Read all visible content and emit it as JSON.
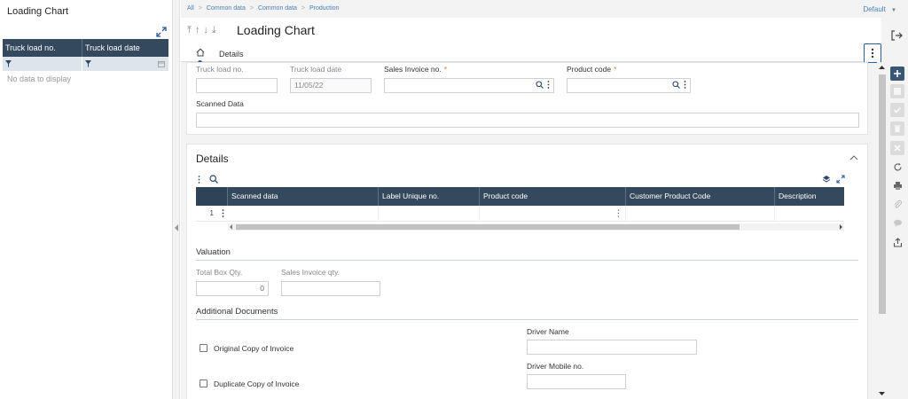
{
  "left_panel": {
    "title": "Loading Chart",
    "columns": [
      "Truck load no.",
      "Truck load date"
    ],
    "empty_text": "No data to display"
  },
  "breadcrumb": [
    "All",
    "Common data",
    "Common data",
    "Production"
  ],
  "default_selector": "Default",
  "header": {
    "title": "Loading Chart",
    "tab": "Details"
  },
  "form": {
    "truck_load_no_label": "Truck load no.",
    "truck_load_no_value": "",
    "truck_load_date_label": "Truck load date",
    "truck_load_date_value": "11/05/22",
    "sales_invoice_label": "Sales Invoice no.",
    "product_code_label": "Product code",
    "scanned_data_label": "Scanned Data"
  },
  "details": {
    "title": "Details",
    "columns": [
      "Scanned data",
      "Label Unique no.",
      "Product code",
      "Customer Product Code",
      "Description"
    ],
    "rows": [
      {
        "num": "1"
      }
    ]
  },
  "valuation": {
    "title": "Valuation",
    "total_box_label": "Total Box Qty.",
    "total_box_value": "0",
    "sales_invoice_qty_label": "Sales Invoice qty."
  },
  "additional_documents": {
    "title": "Additional Documents",
    "original_copy": "Original Copy of Invoice",
    "duplicate_copy": "Duplicate Copy of Invoice",
    "driver_name_label": "Driver Name",
    "driver_mobile_label": "Driver Mobile no."
  },
  "colors": {
    "grid_header": "#34495e",
    "accent": "#2c5aa0",
    "required": "#e67e22"
  }
}
